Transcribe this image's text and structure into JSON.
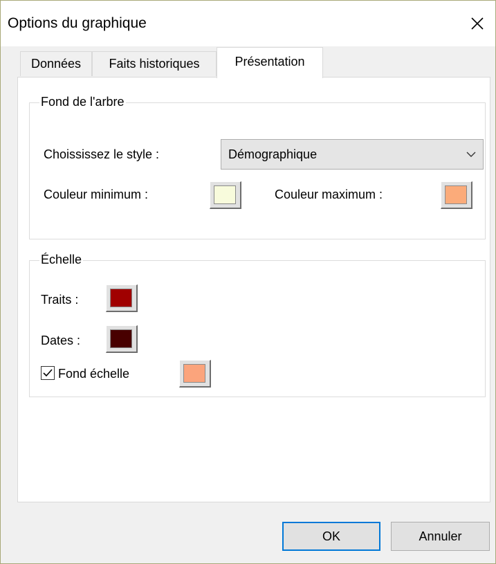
{
  "window": {
    "title": "Options du graphique",
    "close_icon": "close-icon"
  },
  "tabs": [
    {
      "label": "Données",
      "active": false
    },
    {
      "label": "Faits historiques",
      "active": false
    },
    {
      "label": "Présentation",
      "active": true
    }
  ],
  "tree_background": {
    "legend": "Fond de l'arbre",
    "style_label": "Choississez le style :",
    "style_value": "Démographique",
    "min_color_label": "Couleur minimum :",
    "min_color": "#f8fbdc",
    "max_color_label": "Couleur maximum :",
    "max_color": "#fbab7a"
  },
  "scale": {
    "legend": "Échelle",
    "traits_label": "Traits :",
    "traits_color": "#a00000",
    "dates_label": "Dates :",
    "dates_color": "#480000",
    "background_checkbox_label": "Fond échelle",
    "background_checked": true,
    "background_color": "#fba47c"
  },
  "buttons": {
    "ok_label": "OK",
    "cancel_label": "Annuler"
  }
}
